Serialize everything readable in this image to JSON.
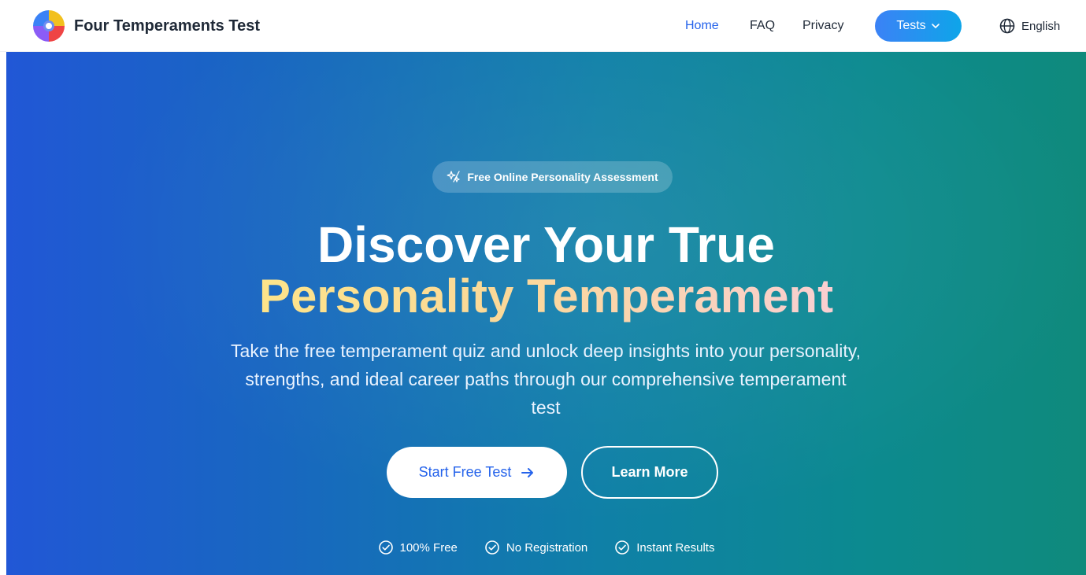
{
  "header": {
    "brand_name": "Four Temperaments Test",
    "nav": {
      "home": "Home",
      "faq": "FAQ",
      "privacy": "Privacy",
      "tests": "Tests",
      "language": "English"
    },
    "accent": "#2563eb"
  },
  "hero": {
    "badge": "Free Online Personality Assessment",
    "title_line1": "Discover Your True",
    "title_line2": "Personality Temperament",
    "subtitle": "Take the free temperament quiz and unlock deep insights into your personality, strengths, and ideal career paths through our comprehensive temperament test",
    "primary_cta": "Start Free Test",
    "secondary_cta": "Learn More",
    "features": [
      "100% Free",
      "No Registration",
      "Instant Results"
    ]
  },
  "icons": {
    "logo": "four-color-circle-logo",
    "tests_dropdown": "chevron-down-icon",
    "language": "globe-icon",
    "badge": "sparkles-icon",
    "cta_arrow": "arrow-right-icon",
    "feature": "check-circle-icon"
  }
}
